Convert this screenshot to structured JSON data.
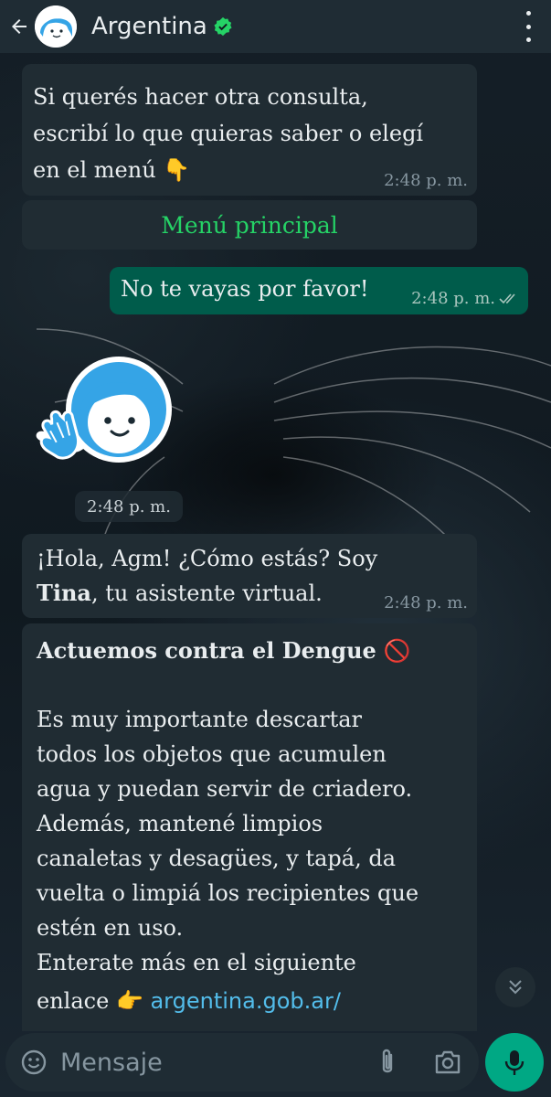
{
  "header": {
    "back_icon": "arrow-left-icon",
    "contact_name": "Argentina",
    "verified_icon": "verified-badge-icon",
    "menu_icon": "more-vertical-icon"
  },
  "messages": {
    "m1": {
      "line1": "Si querés hacer otra consulta,",
      "line2": "escribí lo que quieras saber o elegí",
      "line3": "en el menú",
      "emoji": "👇",
      "time": "2:48 p. m."
    },
    "menu_button": {
      "label": "Menú principal"
    },
    "m2": {
      "text": "No te vayas por favor!",
      "time": "2:48 p. m.",
      "status_icon": "double-check-icon"
    },
    "sticker": {
      "time": "2:48 p. m."
    },
    "m3": {
      "line1": "¡Hola, Agm! ¿Cómo estás? Soy",
      "bold": "Tina",
      "line2_rest": ", tu asistente virtual.",
      "time": "2:48 p. m."
    },
    "m4": {
      "title": "Actuemos contra el Dengue",
      "title_emoji": "🚫",
      "lines": [
        "Es muy importante descartar",
        "todos los objetos que acumulen",
        "agua y puedan servir de criadero.",
        "Además, mantené limpios",
        "canaletas y desagües, y tapá, da",
        "vuelta o limpiá los recipientes que",
        "estén en uso.",
        "Enterate más en el siguiente"
      ],
      "last_prefix": "enlace",
      "last_emoji": "👉",
      "link": "argentina.gob.ar/"
    }
  },
  "composer": {
    "placeholder": "Mensaje",
    "emoji_icon": "emoji-icon",
    "attach_icon": "paperclip-icon",
    "camera_icon": "camera-icon",
    "mic_icon": "microphone-icon",
    "scroll_icon": "chevron-double-down-icon"
  },
  "colors": {
    "header_bg": "#1f2c34",
    "incoming_bubble": "#202c33",
    "outgoing_bubble": "#005c4b",
    "accent_green": "#25d366",
    "link_blue": "#53bdeb",
    "mic_button": "#00a884"
  }
}
